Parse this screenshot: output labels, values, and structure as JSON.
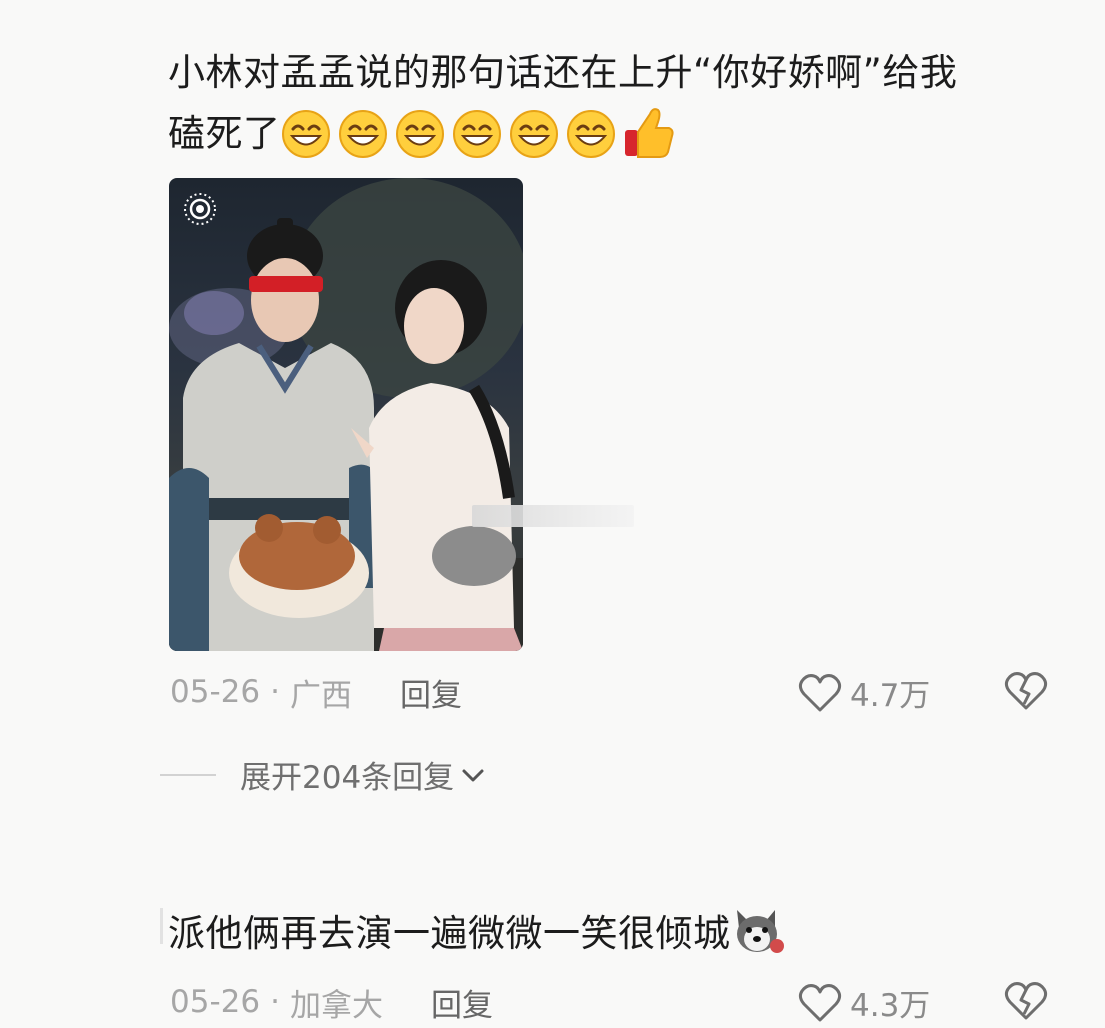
{
  "comments": [
    {
      "text_line1": "小林对孟孟说的那句话还在上升“你好娇啊”给我",
      "text_line2": "磕死了",
      "emojis": [
        "grin-emoji",
        "grin-emoji",
        "grin-emoji",
        "grin-emoji",
        "grin-emoji",
        "grin-emoji",
        "thumbs-up-emoji"
      ],
      "date": "05-26",
      "dot": "·",
      "location": "广西",
      "reply_label": "回复",
      "likes": "4.7万",
      "expand_label": "展开204条回复"
    },
    {
      "text": "派他俩再去演一遍微微一笑很倾城",
      "emoji": "husky-emoji",
      "date": "05-26",
      "dot": "·",
      "location": "加拿大",
      "reply_label": "回复",
      "likes": "4.3万"
    }
  ],
  "icons": {
    "like": "heart-outline-icon",
    "dislike": "broken-heart-icon",
    "expand": "chevron-down-icon",
    "live_photo": "live-photo-icon"
  },
  "colors": {
    "background": "#f9f9f8",
    "text": "#1c1c1c",
    "meta": "#a6a6a6"
  }
}
